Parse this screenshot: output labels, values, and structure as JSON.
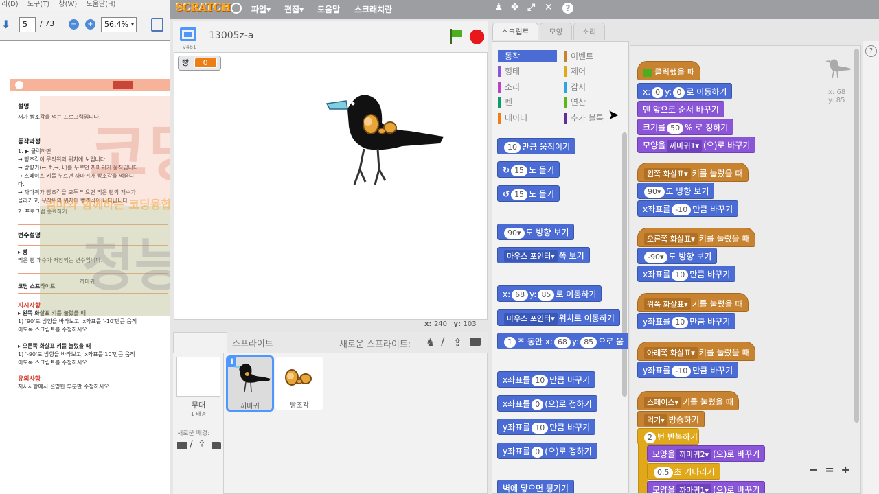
{
  "pdf": {
    "menu": [
      "리(D)",
      "도구(T)",
      "창(W)",
      "도움말(H)"
    ],
    "page_current": "5",
    "page_total": "/ 73",
    "zoom": "56.4%",
    "doc": {
      "desc_title": "설명",
      "desc_text": "새가 빵조각을 먹는 프로그램입니다.",
      "proc_title": "동작과정",
      "steps": [
        "1.  ▶ 클릭하면",
        "  → 빵조각이 무작위의 위치에 보입니다.",
        "  → 방향키(←,↑,→,↓)를 누르면 까마귀가 움직입니다.",
        "  → 스페이스 키를 누르면 까마귀가 빵조각을 먹습니",
        "     다.",
        "  → 까마귀가 빵조각을 모두 먹으면 먹은 빵의 개수가",
        "     올라가고, 무작위의 위치에 빵조각이 나타납니다.",
        "2.  프로그램 종료하기"
      ],
      "var_title": "변수설명",
      "var_name": "▸ 빵",
      "var_desc": "먹은 빵 개수가 저장되는 변수입니다.",
      "sprite_label": "코딩 스프라이트",
      "sprite_name": "까마귀",
      "inst_title": "지시사항",
      "inst": [
        "▸ 왼쪽 화살표 키를 눌렀을 때",
        "  1) '90'도 방향을 바라보고, x좌표를 '-10'만큼 움직",
        "     이도록 스크립트를 수정하시오.",
        "",
        "▸ 오른쪽 화살표 키를 눌렀을 때",
        "  1) '-90'도 방향을 바라보고, x좌표를'10'만큼 움직",
        "     이도록 스크립트를 수정하시오."
      ],
      "note_title": "유의사항",
      "note_text": "지시사항에서 설명한 부분만 수정하시오."
    },
    "watermark": {
      "big1": "코딩",
      "small": "엄마와 함께하는 코딩융합 전문가",
      "big2": "청능쌤"
    }
  },
  "scratch": {
    "logo": "SCRATCH",
    "menu": [
      "파일▾",
      "편집▾",
      "도움말",
      "스크래치란"
    ],
    "project_title": "13005z-a",
    "version": "v461",
    "variable": {
      "name": "빵",
      "value": "0"
    },
    "mouse_x_label": "x:",
    "mouse_x": "240",
    "mouse_y_label": "y:",
    "mouse_y": "103",
    "sprites_label": "스프라이트",
    "new_sprite_label": "새로운 스프라이트:",
    "stage_label": "무대",
    "stage_count": "1 배경",
    "new_backdrop_label": "새로운 배경:",
    "sprite_list": [
      {
        "name": "까마귀"
      },
      {
        "name": "빵조각"
      }
    ],
    "tabs": [
      "스크립트",
      "모양",
      "소리"
    ],
    "categories_left": [
      {
        "label": "동작",
        "color": "#4a6cd4"
      },
      {
        "label": "형태",
        "color": "#8a55d7"
      },
      {
        "label": "소리",
        "color": "#bb42c3"
      },
      {
        "label": "펜",
        "color": "#0e9a6c"
      },
      {
        "label": "데이터",
        "color": "#ee7d16"
      }
    ],
    "categories_right": [
      {
        "label": "이벤트",
        "color": "#c88330"
      },
      {
        "label": "제어",
        "color": "#e1a91a"
      },
      {
        "label": "감지",
        "color": "#2ca5e2"
      },
      {
        "label": "연산",
        "color": "#5cb712"
      },
      {
        "label": "추가 블록",
        "color": "#632d99"
      }
    ],
    "palette": {
      "move": "10",
      "move_t": "만큼 움직이기",
      "turn_r": "15",
      "turn_r_t": "도 돌기",
      "turn_l": "15",
      "turn_l_t": "도 돌기",
      "point": "90▾",
      "point_t": "도 방향 보기",
      "toward": "마우스 포인터▾",
      "toward_t": "쪽 보기",
      "goto_x_l": "x:",
      "goto_x": "68",
      "goto_y_l": "y:",
      "goto_y": "85",
      "goto_t": "로 이동하기",
      "goto2": "마우스 포인터▾",
      "goto2_t": "위치로 이동하기",
      "glide": "1",
      "glide_t1": "초 동안 x:",
      "glide_x": "68",
      "glide_y_l": "y:",
      "glide_y": "85",
      "glide_t2": "으로 움",
      "cx_l": "x좌표를",
      "cx": "10",
      "cx_t": "만큼 바꾸기",
      "sx_l": "x좌표를",
      "sx": "0",
      "sx_t": "(으)로 정하기",
      "cy_l": "y좌표를",
      "cy": "10",
      "cy_t": "만큼 바꾸기",
      "sy_l": "y좌표를",
      "sy": "0",
      "sy_t": "(으)로 정하기",
      "bounce": "벽에 닿으면 튕기기"
    },
    "corner": {
      "x_label": "x:",
      "x": "68",
      "y_label": "y:",
      "y": "85"
    },
    "script": {
      "flag_t": "클릭했을 때",
      "s1_xl": "x:",
      "s1_x": "0",
      "s1_yl": "y:",
      "s1_y": "0",
      "s1_t": "로 이동하기",
      "s2": "맨 앞으로 순서 바꾸기",
      "s3_l": "크기를",
      "s3": "50",
      "s3_t": "% 로 정하기",
      "s4_l": "모양을",
      "s4": "까마귀1▾",
      "s4_t": "(으)로 바꾸기",
      "k_left": "왼쪽 화살표▾",
      "k_t": "키를 눌렀을 때",
      "l1": "90▾",
      "l1_t": "도 방향 보기",
      "l2_l": "x좌표를",
      "l2": "-10",
      "l2_t": "만큼 바꾸기",
      "k_right": "오른쪽 화살표▾",
      "r1": "-90▾",
      "r1_t": "도 방향 보기",
      "r2_l": "x좌표를",
      "r2": "10",
      "r2_t": "만큼 바꾸기",
      "k_up": "위쪽 화살표▾",
      "u1_l": "y좌표를",
      "u1": "10",
      "u1_t": "만큼 바꾸기",
      "k_down": "아래쪽 화살표▾",
      "d1_l": "y좌표를",
      "d1": "-10",
      "d1_t": "만큼 바꾸기",
      "k_space": "스페이스▾",
      "sp1": "먹기▾",
      "sp1_t": "방송하기",
      "sp2": "2",
      "sp2_t": "번 반복하기",
      "sp3_l": "모양을",
      "sp3": "까마귀2▾",
      "sp3_t": "(으)로 바꾸기",
      "sp4": "0.5",
      "sp4_t": "초 기다리기",
      "sp5_l": "모양을",
      "sp5": "까마귀1▾",
      "sp5_t": "(으)로 바꾸기"
    },
    "zoom_controls": [
      "−",
      "=",
      "+"
    ]
  }
}
